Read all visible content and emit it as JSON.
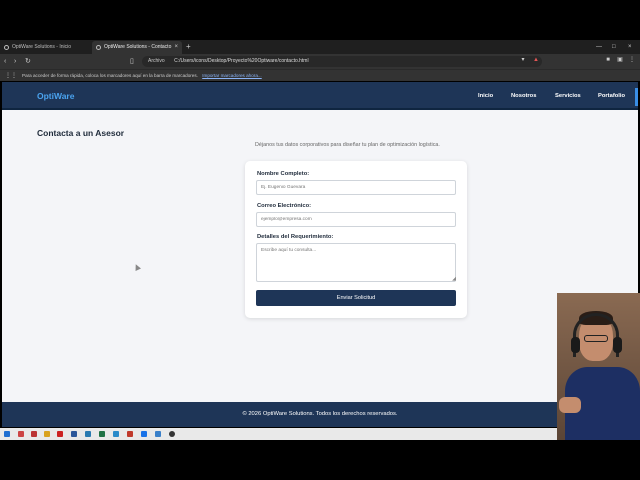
{
  "browser": {
    "tabs": [
      {
        "label": "OptiWare Solutions - Inicio",
        "active": false
      },
      {
        "label": "OptiWare Solutions - Contacto",
        "active": true
      }
    ],
    "address": {
      "scheme_label": "Archivo",
      "url": "C:/Users/icons/Desktop/Proyecto%20Optiware/contacto.html"
    },
    "bookmarks_bar": {
      "text": "Para acceder de forma rápida, coloca los marcadores aquí en la barra de marcadores.",
      "link": "Importar marcadores ahora..."
    }
  },
  "site": {
    "logo": "OptiWare",
    "nav": [
      "Inicio",
      "Nosotros",
      "Servicios",
      "Portafolio"
    ],
    "page_title": "Contacta a un Asesor",
    "subtitle": "Déjanos tus datos corporativos para diseñar tu plan de optimización logística.",
    "form": {
      "name_label": "Nombre Completo:",
      "name_placeholder": "Ej. Eugenio Guevara",
      "email_label": "Correo Electrónico:",
      "email_placeholder": "ejemplo@empresa.com",
      "details_label": "Detalles del Requerimiento:",
      "details_placeholder": "Escribe aquí tu consulta...",
      "submit_label": "Enviar Solicitud"
    },
    "footer": "© 2026 OptiWare Solutions. Todos los derechos reservados."
  },
  "colors": {
    "header_bg": "#1e3557",
    "logo": "#4aa3ef",
    "page_bg": "#f4f5f8",
    "button_bg": "#1e3557"
  }
}
